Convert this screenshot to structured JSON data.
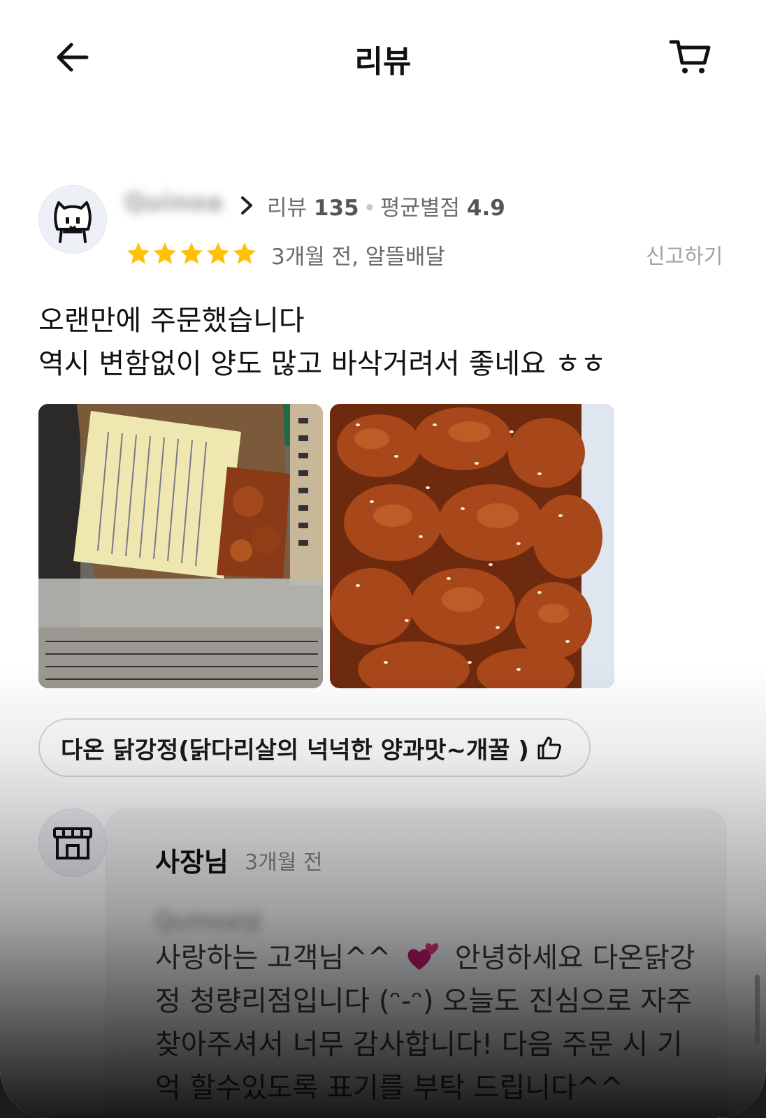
{
  "header": {
    "title": "리뷰"
  },
  "reviewer": {
    "name": "Quinoa",
    "stats_review_label": "리뷰",
    "stats_review_count": "135",
    "stats_rating_label": "평균별점",
    "stats_rating_value": "4.9",
    "rating_stars": 5,
    "meta": "3개월 전, 알뜰배달",
    "report_label": "신고하기"
  },
  "review": {
    "text": "오랜만에 주문했습니다\n역시 변함없이 양도 많고 바삭거려서 좋네요 ㅎㅎ"
  },
  "menu_tag": {
    "label": "다온 닭강정(닭다리살의 넉넉한 양과맛~개꿀 )"
  },
  "owner_reply": {
    "name": "사장님",
    "time": "3개월 전",
    "addressee": "Quinoa님",
    "text_part1": "사랑하는 고객님^^",
    "text_part2": "안녕하세요 다온닭강정 청량리점입니다 (ᵔ-ᵔ) 오늘도 진심으로 자주 찾아주셔서 너무 감사합니다! 다음 주문 시 기억 할수있도록 표기를 부탁 드립니다^^"
  },
  "colors": {
    "star": "#FFC107",
    "text_primary": "#111111",
    "text_secondary": "#6e6e6e"
  },
  "icons": {
    "back": "arrow-left-icon",
    "cart": "cart-icon",
    "chevron": "chevron-right-icon",
    "thumb": "thumbs-up-icon",
    "store": "store-icon",
    "heart": "two-hearts-emoji"
  }
}
